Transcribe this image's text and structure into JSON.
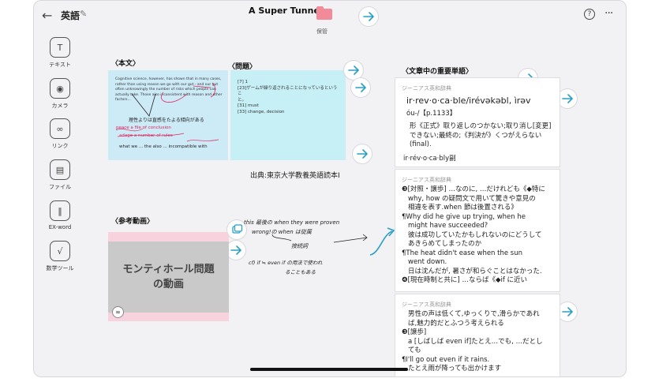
{
  "header": {
    "back_icon": "back-arrow-icon",
    "notebook_title": "英語",
    "doc_title": "A Super Tunnel",
    "folder_label": "保管",
    "help_label": "?",
    "more_label": "···"
  },
  "toolbar": {
    "items": [
      {
        "label": "テキスト",
        "icon": "text-icon",
        "glyph": "T"
      },
      {
        "label": "カメラ",
        "icon": "camera-icon",
        "glyph": "◉"
      },
      {
        "label": "リンク",
        "icon": "link-icon",
        "glyph": "∞"
      },
      {
        "label": "ファイル",
        "icon": "image-file-icon",
        "glyph": "▤"
      },
      {
        "label": "EX-word",
        "icon": "books-icon",
        "glyph": "‖"
      },
      {
        "label": "数学ツール",
        "icon": "math-icon",
        "glyph": "√"
      }
    ]
  },
  "sections": {
    "honbun": "〈本文〉",
    "mondai": "〈問題〉",
    "tango": "〈文章中の重要単語〉",
    "douga": "〈参考動画〉"
  },
  "honbun_card": {
    "text": "Cognitive science, however, has shown that in many cases, rather than using reason we go with our gut - and our gut often unknowingly the number of risks which people can actually take. Those also inconsistent with reason and other factors...",
    "notes": [
      "理性よりは直感をたよる傾向がある",
      "peace a file of conclusion",
      "adage a number of rules",
      "what we ... the also ... incompatible with"
    ]
  },
  "question_card": {
    "lines": [
      "[7] 1",
      "[23]ゲームが繰り返されることになっているというこ",
      "と。",
      "[31] must",
      "[33] change, decision"
    ]
  },
  "source": "出典:東京大学教養英語読本I",
  "video": {
    "title_line1": "モンティホール問題",
    "title_line2": "の動画",
    "link_icon": "link-icon"
  },
  "handnote": {
    "line1": "this 最後の when they were proven",
    "line2": "wrong!の when は従属",
    "line3": "接続詞",
    "line4": "cf) if ≒ even if の用法で使われ",
    "line5": "ることもある"
  },
  "dict1": {
    "source": "ジーニアス英和辞典",
    "headword": "ir·rev·o·ca·ble/irévəkəbl, ìrəv",
    "pron": "óu-/【p.1133】",
    "def1": "形《正式》取り返しのつかない;取り消し[変更]",
    "def2": "できない;最終の;《判決が》くつがえらない",
    "def3": "(final).",
    "derived": "ir·rév·o·ca·bly副"
  },
  "dict2": {
    "source": "ジーニアス英和辞典",
    "lines": [
      "❸[対照・譲歩] …なのに, …だけれども《◆特に",
      "why, how の疑問文で用いて驚きや意見の",
      "相違を表す.when 節は後置される》",
      "¶Why did he give up trying, when he",
      "might have succeeded?",
      "彼は成功していたかもしれないのにどうして",
      "あきらめてしまったのか",
      "¶The heat didn't ease when the sun",
      "went down.",
      "日は沈んだが, 暑さが和らぐことはなかった.",
      "❹[現在時制と共に] …ならば《◆if に近い"
    ]
  },
  "dict3": {
    "source": "ジーニアス英和辞典",
    "lines": [
      "男性の声は低くて,ゆっくりで,滑らかであれ",
      "ば,魅力的だとふつう考えられる",
      "❸[譲歩]",
      "a [しばしば even if]たとえ…でも, …だとし",
      "ても",
      "¶I'll go out even if it rains.",
      "たとえ雨が降っても出かけます"
    ]
  }
}
